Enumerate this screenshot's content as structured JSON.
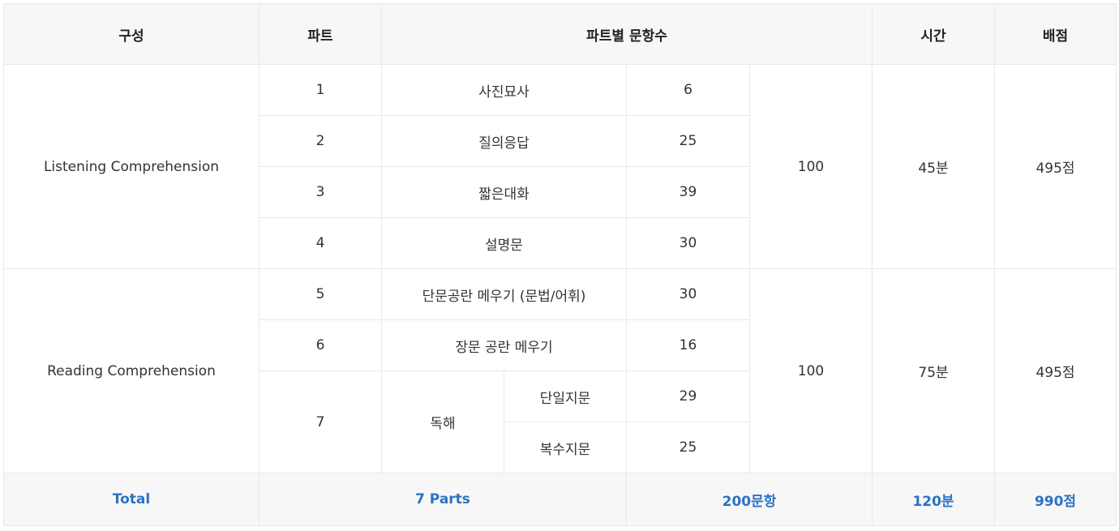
{
  "header": {
    "composition": "구성",
    "part": "파트",
    "questions_per_part": "파트별 문항수",
    "time": "시간",
    "score": "배점"
  },
  "listening": {
    "name": "Listening Comprehension",
    "rows": [
      {
        "part": "1",
        "type": "사진묘사",
        "count": "6"
      },
      {
        "part": "2",
        "type": "질의응답",
        "count": "25"
      },
      {
        "part": "3",
        "type": "짧은대화",
        "count": "39"
      },
      {
        "part": "4",
        "type": "설명문",
        "count": "30"
      }
    ],
    "total": "100",
    "time": "45분",
    "score": "495점"
  },
  "reading": {
    "name": "Reading Comprehension",
    "rows": [
      {
        "part": "5",
        "type": "단문공란 메우기 (문법/어휘)",
        "count": "30"
      },
      {
        "part": "6",
        "type": "장문 공란 메우기",
        "count": "16"
      }
    ],
    "part7": {
      "part": "7",
      "type": "독해",
      "subrows": [
        {
          "type": "단일지문",
          "count": "29"
        },
        {
          "type": "복수지문",
          "count": "25"
        }
      ]
    },
    "total": "100",
    "time": "75분",
    "score": "495점"
  },
  "footer": {
    "label": "Total",
    "parts": "7 Parts",
    "questions": "200문항",
    "time": "120분",
    "score": "990점"
  }
}
